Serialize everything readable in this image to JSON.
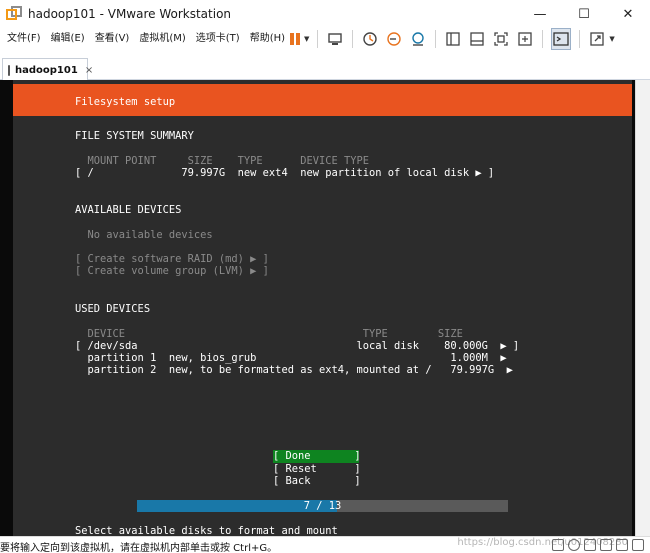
{
  "window": {
    "title": "hadoop101 - VMware Workstation",
    "minimize_glyph": "—",
    "maximize_glyph": "☐",
    "close_glyph": "✕"
  },
  "menu": [
    "文件(F)",
    "编辑(E)",
    "查看(V)",
    "虚拟机(M)",
    "选项卡(T)",
    "帮助(H)"
  ],
  "toolbar_icons": [
    "pause-icon",
    "send-ctrl-alt-del-icon",
    "snapshot-icon",
    "revert-snapshot-icon",
    "snapshot-manager-icon",
    "library-icon",
    "console-view-icon",
    "fit-guest-icon",
    "full-screen-icon",
    "terminal-icon",
    "stretch-icon"
  ],
  "colors": {
    "accent_orange": "#e95420",
    "done_green": "#0e8420",
    "progress_blue": "#1978a8",
    "pause_orange": "#e8731f"
  },
  "tab": {
    "label": "hadoop101",
    "close": "×"
  },
  "installer": {
    "header": "Filesystem setup",
    "fs_summary_title": "FILE SYSTEM SUMMARY",
    "fs_header": "  MOUNT POINT     SIZE    TYPE      DEVICE TYPE",
    "fs_row": "[ /              79.997G  new ext4  new partition of local disk ▶ ]",
    "avail_title": "AVAILABLE DEVICES",
    "no_devices": "  No available devices",
    "raid": "[ Create software RAID (md) ▶ ]",
    "lvm": "[ Create volume group (LVM) ▶ ]",
    "used_title": "USED DEVICES",
    "used_header": "  DEVICE                                      TYPE        SIZE",
    "used_rows": [
      "[ /dev/sda                                   local disk    80.000G  ▶ ]",
      "  partition 1  new, bios_grub                               1.000M  ▶",
      "  partition 2  new, to be formatted as ext4, mounted at /   79.997G  ▶"
    ],
    "buttons": {
      "done": "[ Done       ]",
      "reset": "[ Reset      ]",
      "back": "[ Back       ]"
    },
    "progress": {
      "text": "7 / 13",
      "current": 7,
      "total": 13
    },
    "hint": "Select available disks to format and mount"
  },
  "status": {
    "text": "要将输入定向到该虚拟机，请在虚拟机内部单击或按 Ctrl+G。",
    "watermark": "https://blog.csdn.net/u012408280"
  }
}
